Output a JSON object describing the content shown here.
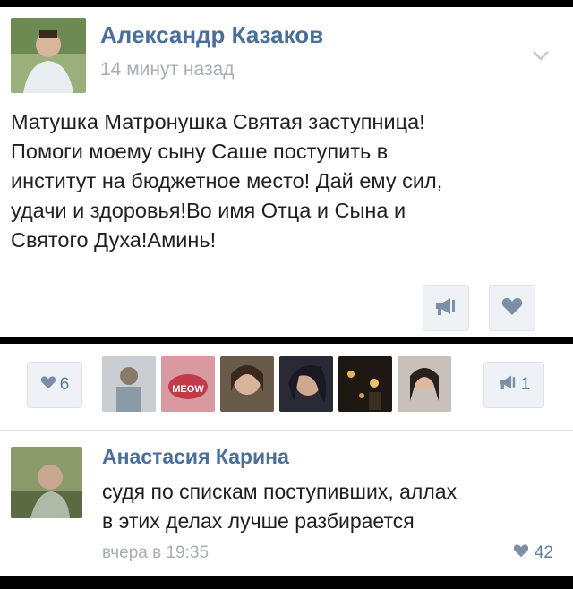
{
  "post": {
    "author": "Александр Казаков",
    "time": "14 минут назад",
    "text": "Матушка Матронушка Святая заступница!\nПомоги моему сыну Саше поступить в\nинститут на бюджетное место! Дай ему сил,\nудачи и здоровья!Во имя Отца и Сына и\nСвятого Духа!Аминь!",
    "icons": {
      "menu": "chevron-down-icon",
      "repost": "megaphone-icon",
      "like": "heart-icon"
    }
  },
  "likes_bar": {
    "likes_count": "6",
    "reposts_count": "1",
    "likers": [
      {
        "name": "liker-avatar-1",
        "color": "#8a9aa6"
      },
      {
        "name": "liker-avatar-2",
        "color": "#c23a4a",
        "label": "MEOW"
      },
      {
        "name": "liker-avatar-3",
        "color": "#b58a6a"
      },
      {
        "name": "liker-avatar-4",
        "color": "#6b6a78"
      },
      {
        "name": "liker-avatar-5",
        "color": "#3a2e22"
      },
      {
        "name": "liker-avatar-6",
        "color": "#a88a7a"
      }
    ]
  },
  "comment": {
    "author": "Анастасия Карина",
    "text": "судя по спискам поступивших, аллах\nв этих делах лучше разбирается",
    "time": "вчера в 19:35",
    "likes": "42"
  },
  "colors": {
    "accent": "#4a6f9b",
    "muted": "#a8adb3",
    "button_bg": "#eef1f5"
  }
}
